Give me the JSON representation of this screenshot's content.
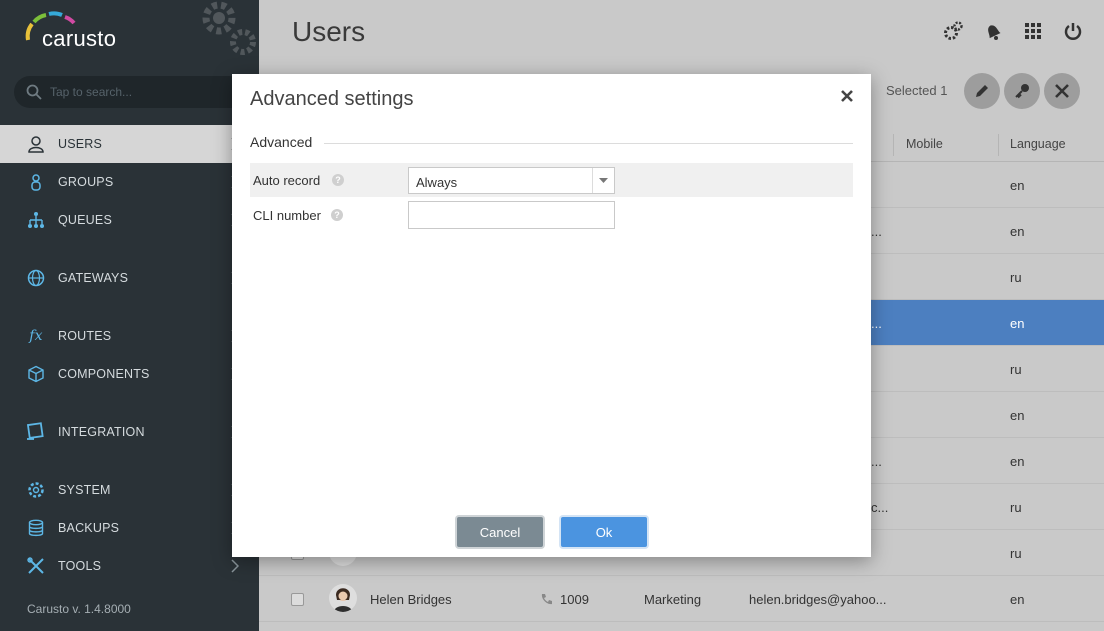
{
  "app": {
    "brand": "carusto",
    "version": "Carusto v. 1.4.8000"
  },
  "search": {
    "placeholder": "Tap to search..."
  },
  "sidebar": {
    "items": [
      {
        "label": "USERS",
        "icon": "user-icon",
        "active": true
      },
      {
        "label": "GROUPS",
        "icon": "groups-icon"
      },
      {
        "label": "QUEUES",
        "icon": "queues-icon"
      },
      {
        "label": "GATEWAYS",
        "icon": "globe-icon"
      },
      {
        "label": "ROUTES",
        "icon": "fx-icon"
      },
      {
        "label": "COMPONENTS",
        "icon": "cube-icon"
      },
      {
        "label": "INTEGRATION",
        "icon": "integration-icon"
      },
      {
        "label": "SYSTEM",
        "icon": "gear-icon"
      },
      {
        "label": "BACKUPS",
        "icon": "database-icon"
      },
      {
        "label": "TOOLS",
        "icon": "tools-icon"
      }
    ]
  },
  "header": {
    "title": "Users",
    "selected": "Selected 1",
    "icons": [
      "settings-icon",
      "bell-icon",
      "apps-grid-icon",
      "power-icon"
    ]
  },
  "table": {
    "columns": {
      "mobile": "Mobile",
      "language": "Language"
    },
    "rows": [
      {
        "email": "",
        "language": "en"
      },
      {
        "email": "...",
        "language": "en"
      },
      {
        "email": "",
        "language": "ru"
      },
      {
        "email": "...",
        "language": "en",
        "selected": true
      },
      {
        "email": "",
        "language": "ru"
      },
      {
        "email": "",
        "language": "en"
      },
      {
        "email": "...",
        "language": "en"
      },
      {
        "email": "c...",
        "language": "ru"
      },
      {
        "email": "",
        "language": "ru"
      },
      {
        "name": "Helen Bridges",
        "ext": "1009",
        "group": "Marketing",
        "email": "helen.bridges@yahoo...",
        "language": "en"
      }
    ]
  },
  "modal": {
    "title": "Advanced settings",
    "section": "Advanced",
    "fields": {
      "auto_record_label": "Auto record",
      "auto_record_value": "Always",
      "cli_label": "CLI number",
      "cli_value": ""
    },
    "buttons": {
      "cancel": "Cancel",
      "ok": "Ok"
    }
  },
  "colors": {
    "sidebar_bg": "#2a3237",
    "selected_row": "#4c7fc0",
    "ok_button": "#4b94e0",
    "cancel_button": "#7b8a93"
  }
}
